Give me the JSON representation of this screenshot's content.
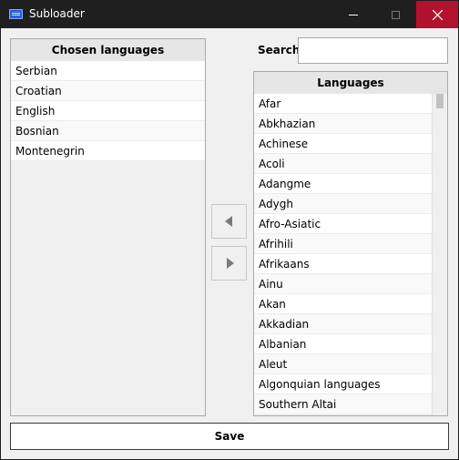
{
  "window": {
    "title": "Subloader"
  },
  "chosen": {
    "header": "Chosen languages",
    "items": [
      "Serbian",
      "Croatian",
      "English",
      "Bosnian",
      "Montenegrin"
    ]
  },
  "search": {
    "label": "Search:",
    "value": ""
  },
  "languages": {
    "header": "Languages",
    "items": [
      "Afar",
      "Abkhazian",
      "Achinese",
      "Acoli",
      "Adangme",
      "Adygh",
      "Afro-Asiatic",
      "Afrihili",
      "Afrikaans",
      "Ainu",
      "Akan",
      "Akkadian",
      "Albanian",
      "Aleut",
      "Algonquian languages",
      "Southern Altai"
    ]
  },
  "actions": {
    "save_label": "Save"
  },
  "icons": {
    "move_left": "left-arrow-icon",
    "move_right": "right-arrow-icon"
  }
}
